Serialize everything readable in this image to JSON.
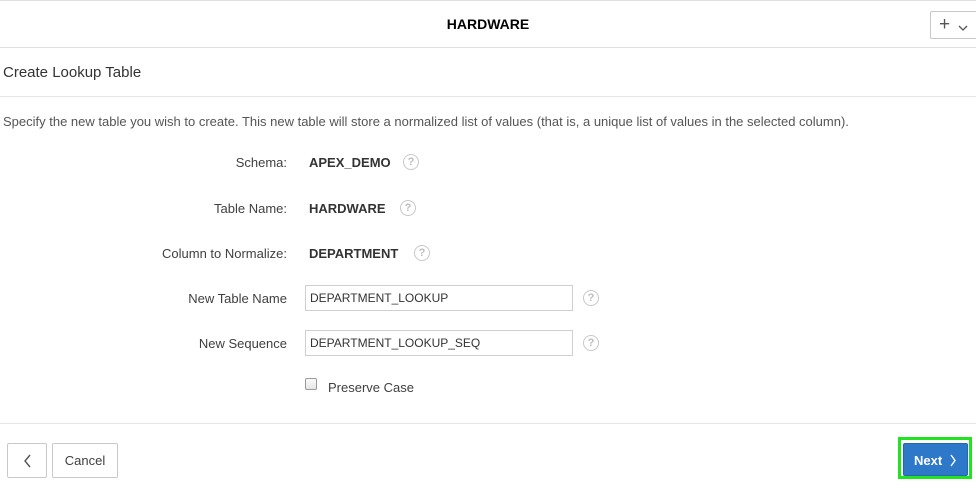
{
  "header": {
    "title": "HARDWARE",
    "add_icon": "plus-icon",
    "menu_icon": "chevron-down-icon"
  },
  "region": {
    "title": "Create Lookup Table",
    "description": "Specify the new table you wish to create. This new table will store a normalized list of values (that is, a unique list of values in the selected column)."
  },
  "form": {
    "schema": {
      "label": "Schema:",
      "value": "APEX_DEMO"
    },
    "table_name": {
      "label": "Table Name:",
      "value": "HARDWARE"
    },
    "column": {
      "label": "Column to Normalize:",
      "value": "DEPARTMENT"
    },
    "new_table_name": {
      "label": "New Table Name",
      "value": "DEPARTMENT_LOOKUP"
    },
    "new_sequence": {
      "label": "New Sequence",
      "value": "DEPARTMENT_LOOKUP_SEQ"
    },
    "preserve_case": {
      "label": "Preserve Case",
      "checked": false
    },
    "help_glyph": "?"
  },
  "footer": {
    "back_icon": "chevron-left-icon",
    "cancel_label": "Cancel",
    "next_label": "Next",
    "next_icon": "chevron-right-icon"
  },
  "colors": {
    "primary": "#2d78c8",
    "highlight": "#22e322"
  }
}
